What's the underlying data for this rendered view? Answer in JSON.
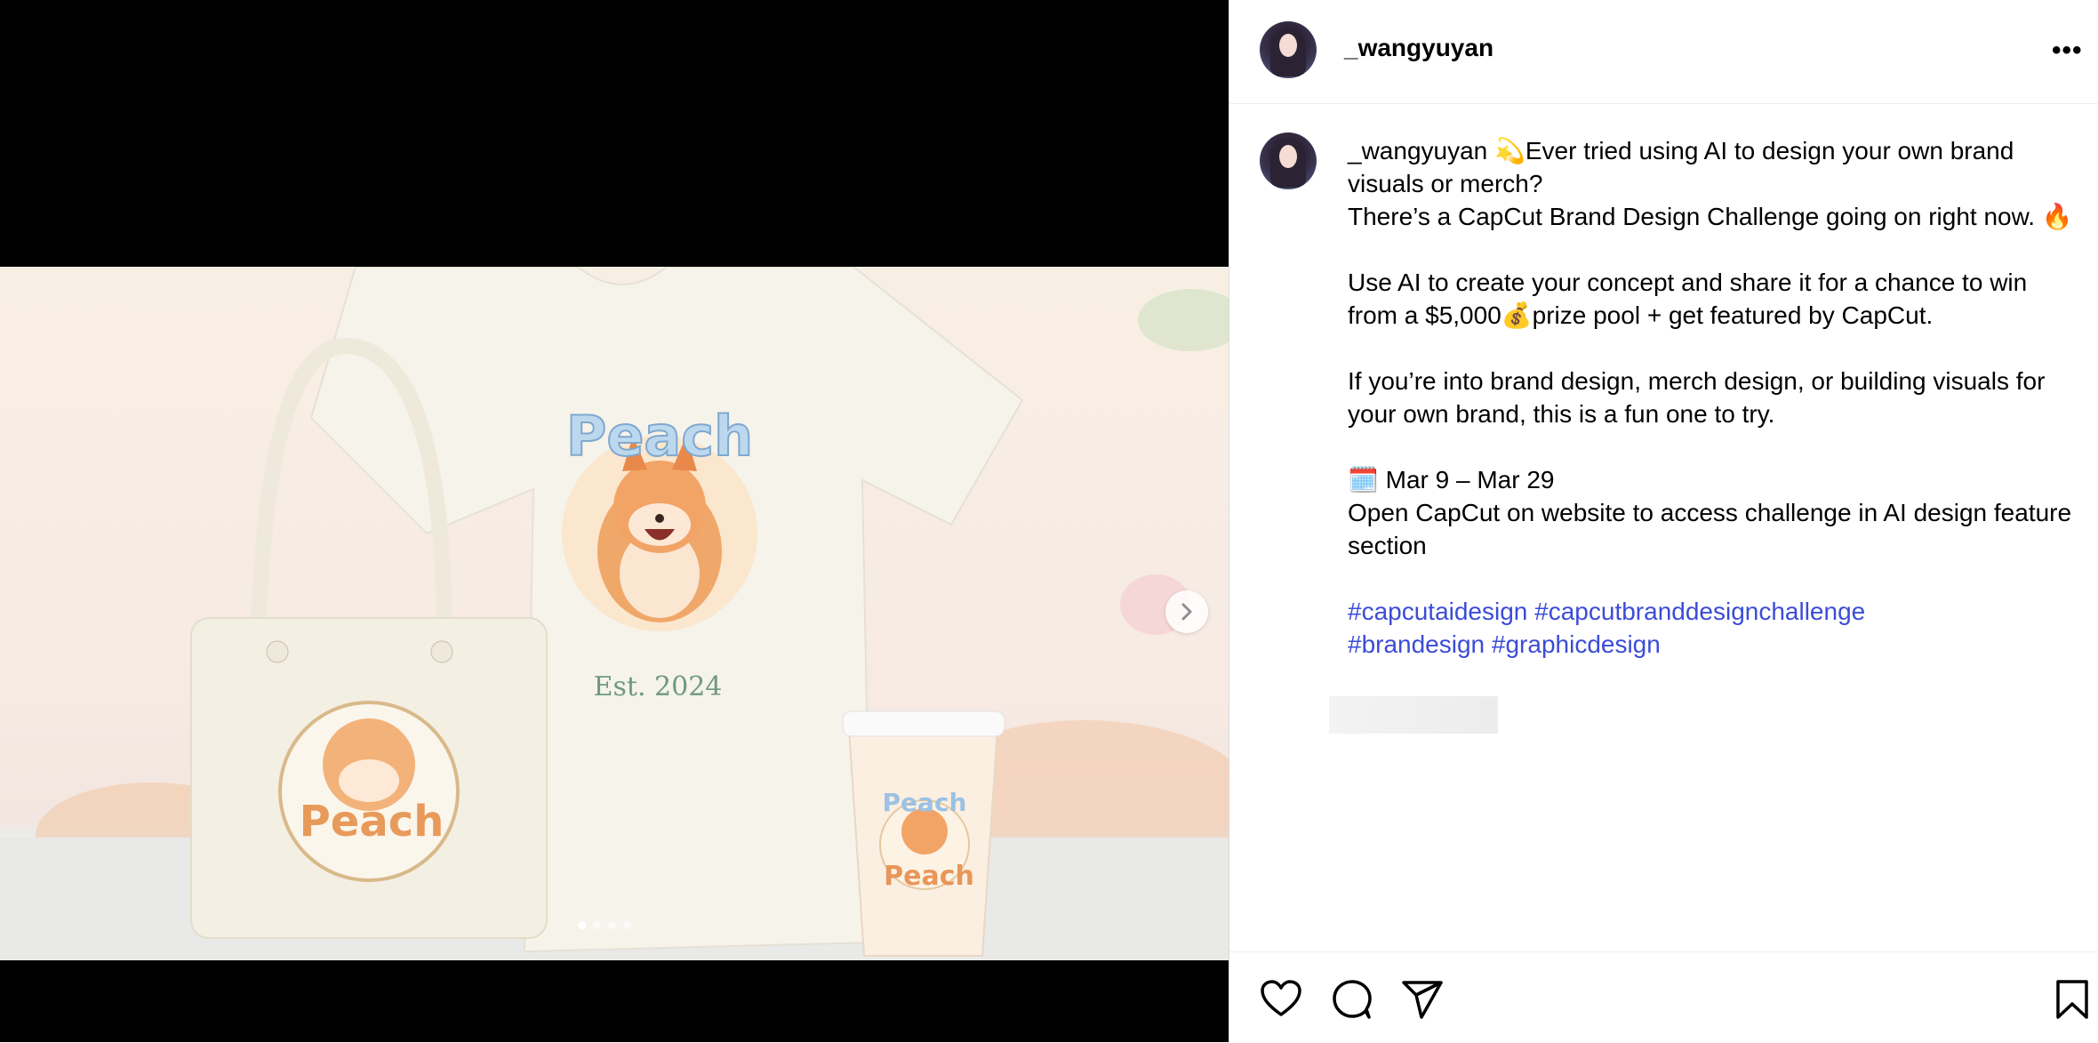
{
  "post": {
    "username": "_wangyuyan",
    "more_label": "•••"
  },
  "media": {
    "image_description": "",
    "carousel": {
      "count": 4,
      "active_index": 0
    }
  },
  "caption": {
    "username": "_wangyuyan",
    "line1": "💫Ever tried using AI to design your own brand visuals or merch?",
    "line2": "There’s a CapCut Brand Design Challenge going on right now. 🔥",
    "para2": "Use AI to create your concept and share it for a chance to win from a $5,000💰prize pool + get featured by CapCut.",
    "para3": "If you’re into brand design, merch design, or building visuals for your own brand, this is a fun one to try.",
    "dates": "🗓️ Mar 9 – Mar 29",
    "instructions": "Open CapCut on website to access challenge in AI design feature section",
    "hashtags": [
      "#capcutaidesign",
      "#capcutbranddesignchallenge",
      "#brandesign",
      "#graphicdesign"
    ]
  },
  "artwork": {
    "shirt_title": "Peach",
    "shirt_subtitle": "Est. 2024",
    "bag_title": "Peach",
    "cup_title_top": "Peach",
    "cup_title_bottom": "Peach"
  },
  "actions": {
    "like": "heart-icon",
    "comment": "comment-icon",
    "share": "share-icon",
    "save": "bookmark-icon"
  },
  "colors": {
    "hashtag": "#3b4cd6",
    "media_bg": "#000000"
  }
}
